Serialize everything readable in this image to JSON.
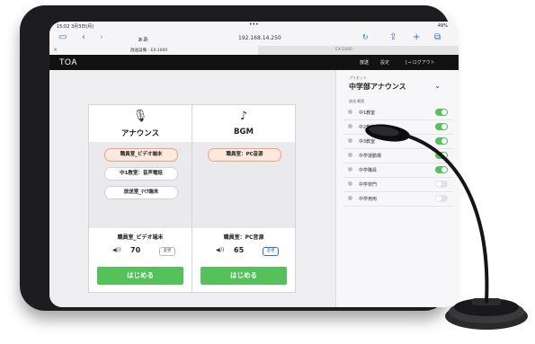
{
  "status": {
    "time": "15:02 3月3日(月)",
    "dots": "•••",
    "battery": "49%"
  },
  "browser": {
    "address_aa": "ぁあ",
    "url": "192.168.14.250",
    "tab1": "放送設備 - EX-1000",
    "tab2": "EX-1000"
  },
  "app": {
    "logo": "TOA",
    "nav_broadcast": "放送",
    "nav_settings": "設定",
    "nav_logout": "[→ ログアウト"
  },
  "cards": [
    {
      "title": "アナウンス",
      "icon": "microphone-icon",
      "sources": [
        "職員室_ビデオ端末",
        "中1教室：音声電話",
        "放送室_ﾏｲｸ端末"
      ],
      "current": "職員室_ビデオ端末",
      "volume": "70",
      "change": "変更",
      "start": "はじめる"
    },
    {
      "title": "BGM",
      "icon": "music-note-icon",
      "sources": [
        "職員室：PC音源"
      ],
      "current": "職員室：PC音源",
      "volume": "65",
      "change": "変更",
      "start": "はじめる"
    }
  ],
  "sidebar": {
    "preset_label": "プリセット",
    "preset_value": "中学部アナウンス",
    "zone_header": "放送 範囲",
    "zones": [
      {
        "name": "中1教室",
        "on": true
      },
      {
        "name": "中2教室",
        "on": true
      },
      {
        "name": "中3教室",
        "on": true
      },
      {
        "name": "中学運動場",
        "on": true
      },
      {
        "name": "中学職員",
        "on": true
      },
      {
        "name": "中学校門",
        "on": false
      },
      {
        "name": "中学用用",
        "on": false
      }
    ]
  },
  "colors": {
    "accent_green": "#55c15b",
    "selected_chip": "#fde9dd",
    "appbar": "#121212",
    "link_blue": "#2a6de0"
  }
}
